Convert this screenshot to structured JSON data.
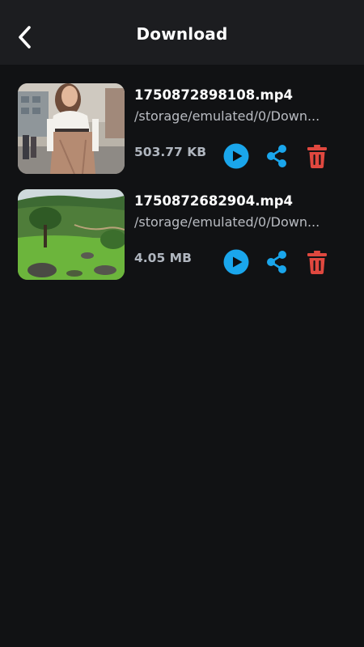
{
  "header": {
    "title": "Download",
    "back_icon": "chevron-left-icon"
  },
  "colors": {
    "background": "#111214",
    "header_background": "#1c1d20",
    "play_button": "#1aa6ec",
    "share_icon": "#1aa6ec",
    "delete_icon": "#e0483f"
  },
  "downloads": [
    {
      "name": "1750872898108.mp4",
      "path": "/storage/emulated/0/Down...",
      "size": "503.77 KB",
      "thumbnail": "woman-on-street-thumbnail"
    },
    {
      "name": "1750872682904.mp4",
      "path": "/storage/emulated/0/Down...",
      "size": "4.05 MB",
      "thumbnail": "green-hills-landscape-thumbnail"
    }
  ],
  "actions": {
    "play_icon": "play-circle-icon",
    "share_icon": "share-icon",
    "delete_icon": "trash-icon"
  }
}
